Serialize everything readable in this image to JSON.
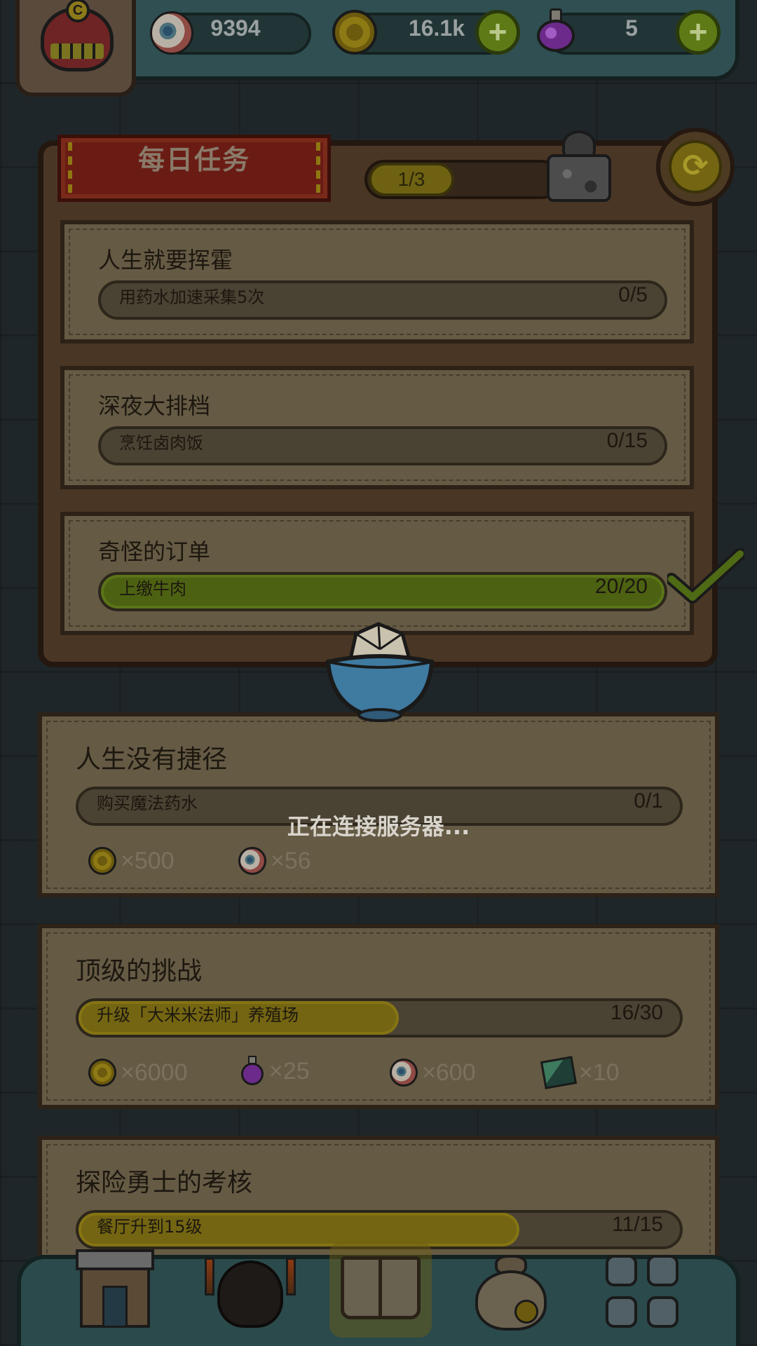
{
  "resources": {
    "eyes": "9394",
    "coins": "16.1k",
    "potions": "5",
    "add_label": "+"
  },
  "avatar": {
    "badge": "C"
  },
  "daily": {
    "title": "每日任务",
    "progress": "1/3",
    "refresh_glyph": "⟳",
    "missions": [
      {
        "title": "人生就要挥霍",
        "desc": "用药水加速采集5次",
        "count": "0/5",
        "progress": 0.0,
        "completed": false
      },
      {
        "title": "深夜大排档",
        "desc": "烹饪卤肉饭",
        "count": "0/15",
        "progress": 0.0,
        "completed": false
      },
      {
        "title": "奇怪的订单",
        "desc": "上缴牛肉",
        "count": "20/20",
        "progress": 1.0,
        "completed": true
      }
    ]
  },
  "challenges": [
    {
      "title": "人生没有捷径",
      "desc": "购买魔法药水",
      "count": "0/1",
      "progress": 0.0,
      "rewards": [
        {
          "icon": "coin-icon",
          "amount": "×500"
        },
        {
          "icon": "eye-icon",
          "amount": "×56"
        }
      ]
    },
    {
      "title": "顶级的挑战",
      "desc": "升级「大米米法师」养殖场",
      "count": "16/30",
      "progress": 0.533,
      "rewards": [
        {
          "icon": "coin-icon",
          "amount": "×6000"
        },
        {
          "icon": "potion-icon",
          "amount": "×25"
        },
        {
          "icon": "eye-icon",
          "amount": "×600"
        },
        {
          "icon": "card-icon",
          "amount": "×10"
        }
      ]
    },
    {
      "title": "探险勇士的考核",
      "desc": "餐厅升到15级",
      "count": "11/15",
      "progress": 0.733
    }
  ],
  "status": {
    "connecting": "正在连接服务器..."
  },
  "nav": [
    "shop-icon",
    "monster-icon",
    "quest-book-icon",
    "coin-bag-icon",
    "grid-menu-icon"
  ],
  "colors": {
    "green_fill": "#4c6212",
    "yellow_fill": "#736512",
    "overlay_text": "#d8d4cc"
  }
}
